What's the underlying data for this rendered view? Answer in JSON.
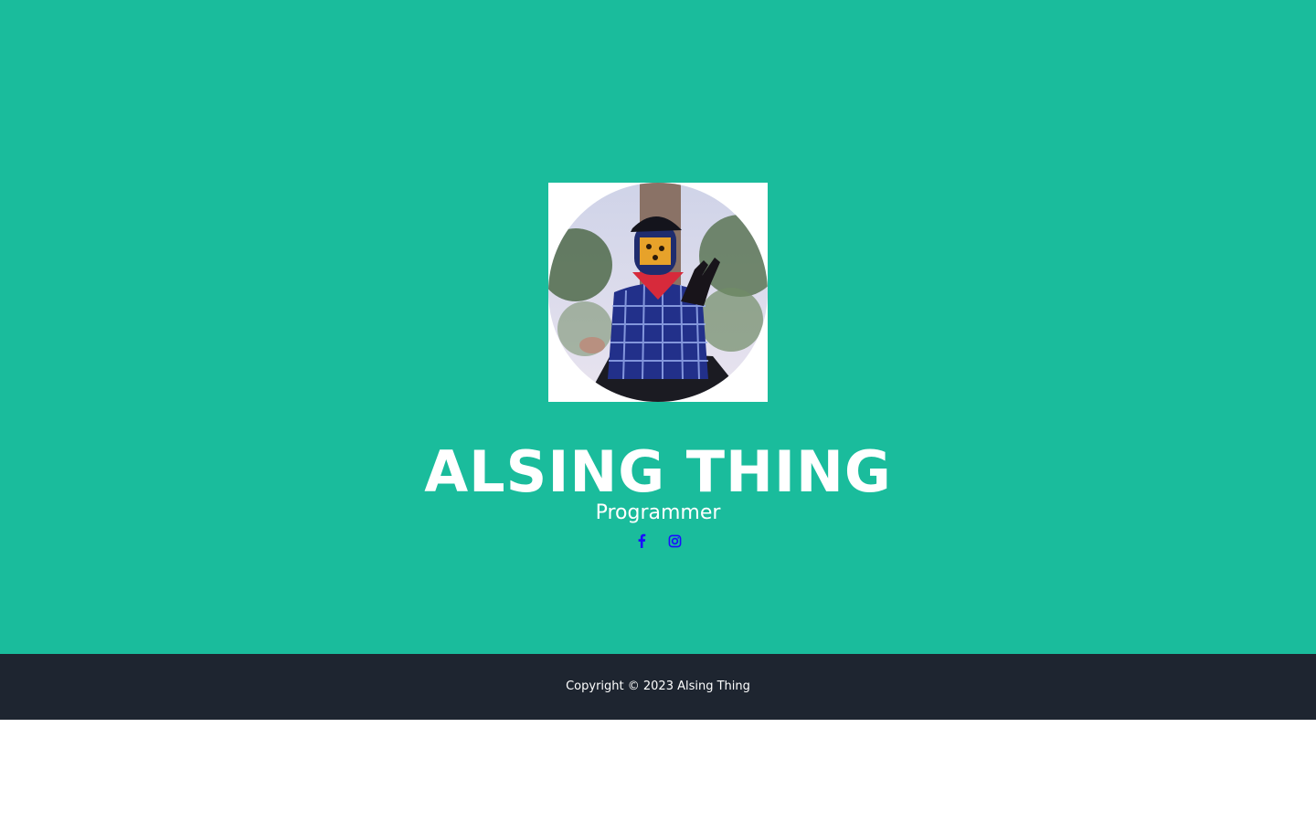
{
  "profile": {
    "name": "ALSING THING",
    "role": "Programmer"
  },
  "social": [
    {
      "icon": "facebook-icon"
    },
    {
      "icon": "instagram-icon"
    }
  ],
  "footer": {
    "copyright": "Copyright © 2023 Alsing Thing"
  },
  "colors": {
    "masthead_bg": "#1abc9c",
    "footer_bg": "#1e2530",
    "social_link": "#1a0dff"
  }
}
